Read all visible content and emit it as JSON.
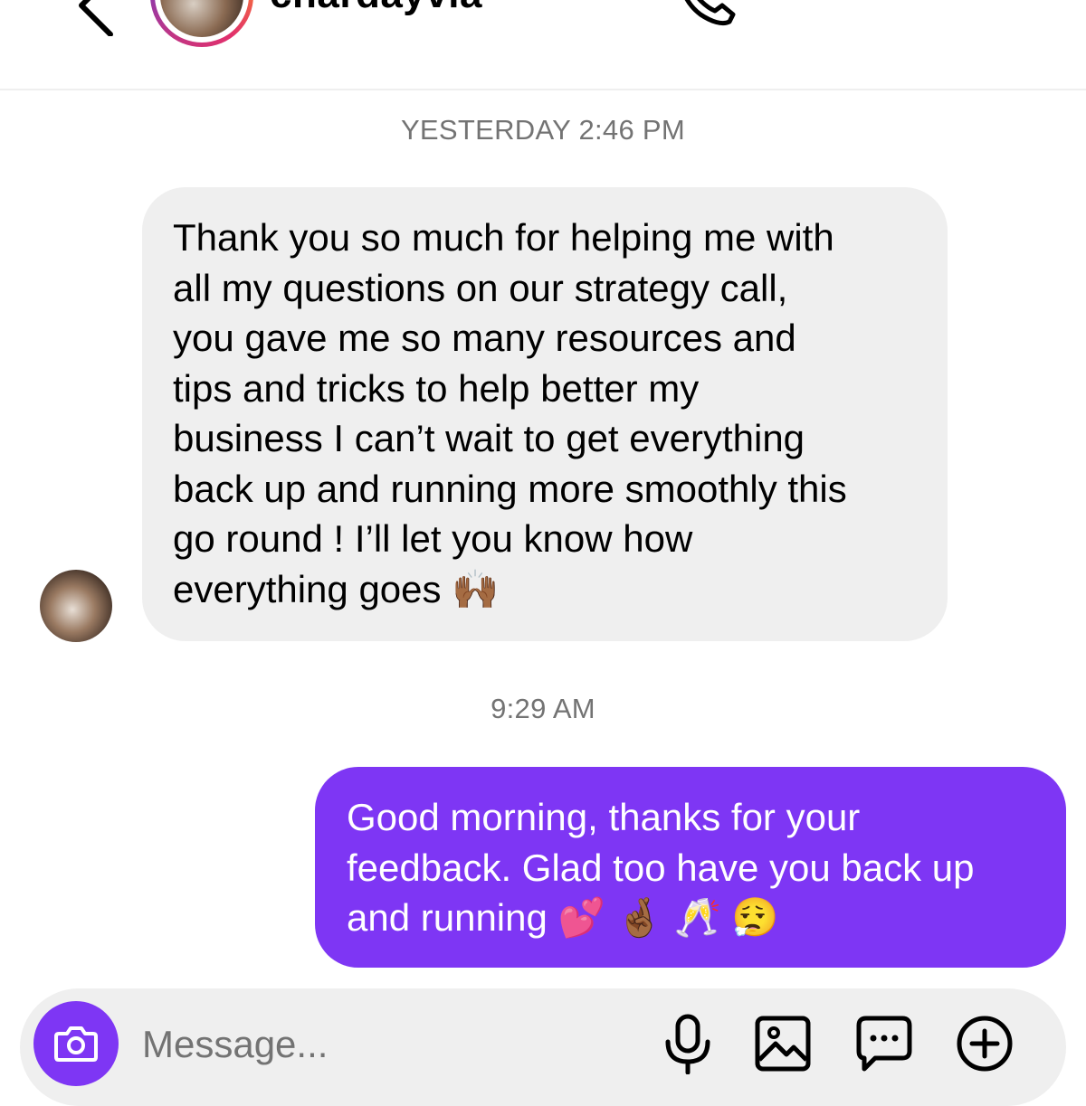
{
  "header": {
    "username": "chardayvia",
    "icons": [
      "back-chevron-icon",
      "phone-icon",
      "video-camera-icon",
      "tag-icon"
    ]
  },
  "conversation": {
    "timestamp_1": "YESTERDAY 2:46 PM",
    "incoming_message": "Thank you so much for helping me with\nall my questions on our strategy call,\nyou gave me so many resources and\ntips and tricks to help better my\nbusiness I can’t wait to get everything\nback up and running more smoothly this\ngo round ! I’ll let you know how\neverything goes 🙌🏾",
    "timestamp_2": "9:29 AM",
    "outgoing_message": "Good morning, thanks for your\nfeedback. Glad too have you back up\nand running 💕 🤞🏾 🥂 😮‍💨"
  },
  "composer": {
    "placeholder": "Message...",
    "icons": [
      "camera-icon",
      "microphone-icon",
      "gallery-icon",
      "sticker-chat-icon",
      "plus-icon"
    ]
  },
  "colors": {
    "outgoing_bubble": "#7e36f4",
    "incoming_bubble": "#efefef",
    "timestamp": "#737373"
  }
}
